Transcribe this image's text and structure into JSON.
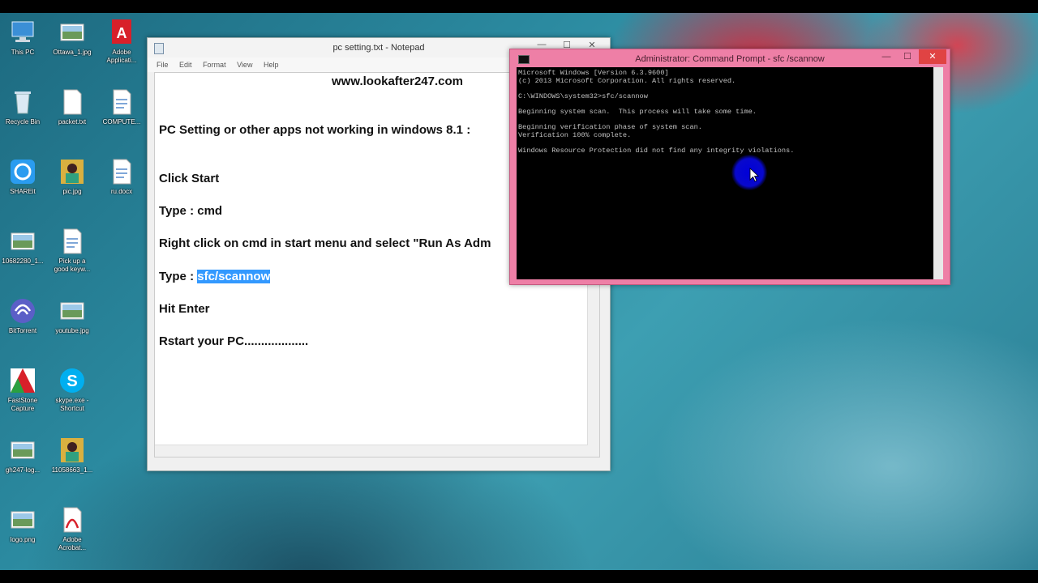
{
  "desktop_icons": [
    {
      "label": "This PC",
      "icon": "computer-icon",
      "col": 0,
      "row": 0
    },
    {
      "label": "Ottawa_1.jpg",
      "icon": "image-file-icon",
      "col": 1,
      "row": 0
    },
    {
      "label": "Adobe\nApplicati...",
      "icon": "adobe-icon",
      "col": 2,
      "row": 0
    },
    {
      "label": "Recycle Bin",
      "icon": "recycle-bin-icon",
      "col": 0,
      "row": 1
    },
    {
      "label": "packet.txt",
      "icon": "text-file-icon",
      "col": 1,
      "row": 1
    },
    {
      "label": "COMPUTE...",
      "icon": "document-file-icon",
      "col": 2,
      "row": 1
    },
    {
      "label": "SHAREit",
      "icon": "shareit-icon",
      "col": 0,
      "row": 2
    },
    {
      "label": "pic.jpg",
      "icon": "photo-file-icon",
      "col": 1,
      "row": 2
    },
    {
      "label": "ru.docx",
      "icon": "document-file-icon",
      "col": 2,
      "row": 2
    },
    {
      "label": "10682280_1...",
      "icon": "image-file-icon",
      "col": 0,
      "row": 3
    },
    {
      "label": "Pick up a\ngood keyw...",
      "icon": "document-file-icon",
      "col": 1,
      "row": 3
    },
    {
      "label": "BitTorrent",
      "icon": "bittorrent-icon",
      "col": 0,
      "row": 4
    },
    {
      "label": "youtube.jpg",
      "icon": "image-file-icon",
      "col": 1,
      "row": 4
    },
    {
      "label": "FastStone\nCapture",
      "icon": "faststone-icon",
      "col": 0,
      "row": 5
    },
    {
      "label": "skype.exe -\nShortcut",
      "icon": "skype-icon",
      "col": 1,
      "row": 5
    },
    {
      "label": "gh247-log...",
      "icon": "image-file-icon",
      "col": 0,
      "row": 6
    },
    {
      "label": "11058663_1...",
      "icon": "photo-file-icon",
      "col": 1,
      "row": 6
    },
    {
      "label": "logo.png",
      "icon": "image-file-icon",
      "col": 0,
      "row": 7
    },
    {
      "label": "Adobe\nAcrobat...",
      "icon": "acrobat-icon",
      "col": 1,
      "row": 7
    }
  ],
  "notepad": {
    "title": "pc setting.txt - Notepad",
    "menu": [
      "File",
      "Edit",
      "Format",
      "View",
      "Help"
    ],
    "controls": {
      "minimize": "—",
      "maximize": "☐",
      "close": "✕"
    },
    "lines": [
      "www.lookafter247.com",
      "PC Setting or other apps not working in windows 8.1 :",
      "Click Start",
      "Type : cmd",
      "Right click on cmd in start menu and select  \"Run As Adm",
      "Type : ",
      "Hit Enter",
      "Rstart your PC..................."
    ],
    "selected_text": "sfc/scannow"
  },
  "cmd": {
    "title": "Administrator: Command Prompt - sfc /scannow",
    "controls": {
      "minimize": "—",
      "maximize": "☐",
      "close": "✕"
    },
    "lines": [
      "Microsoft Windows [Version 6.3.9600]",
      "(c) 2013 Microsoft Corporation. All rights reserved.",
      "C:\\WINDOWS\\system32>sfc/scannow",
      "Beginning system scan.  This process will take some time.",
      "Beginning verification phase of system scan.",
      "Verification 100% complete.",
      "Windows Resource Protection did not find any integrity violations."
    ]
  }
}
